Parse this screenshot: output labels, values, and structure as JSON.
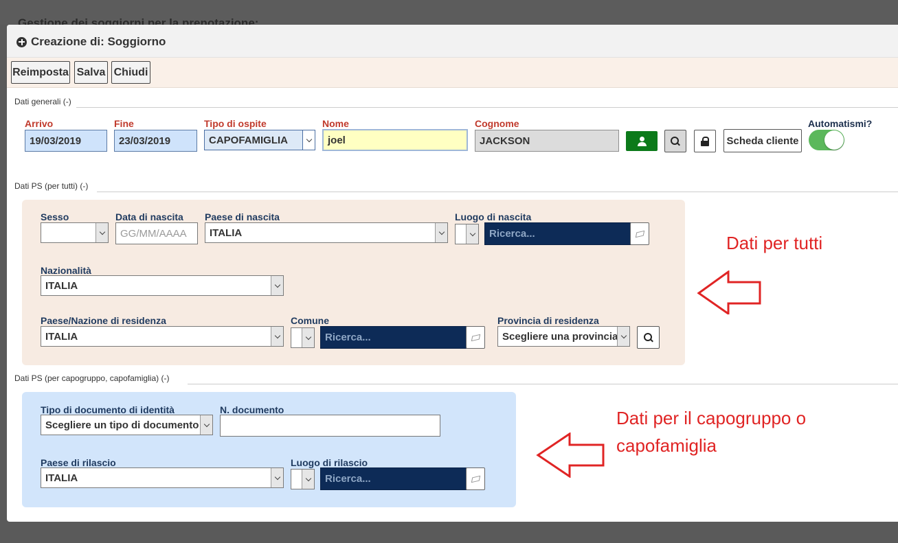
{
  "background": {
    "page_title": "Gestione dei soggiorni per la prenotazione:"
  },
  "dialog": {
    "title": "Creazione di: Soggiorno",
    "icon": "plus-circle-icon"
  },
  "toolbar": {
    "reset_label": "Reimposta",
    "save_label": "Salva",
    "close_label": "Chiudi"
  },
  "general": {
    "section_label": "Dati generali (-)",
    "arrivo_label": "Arrivo",
    "arrivo_value": "19/03/2019",
    "fine_label": "Fine",
    "fine_value": "23/03/2019",
    "tipo_label": "Tipo di ospite",
    "tipo_value": "CAPOFAMIGLIA",
    "nome_label": "Nome",
    "nome_value": "joel",
    "cognome_label": "Cognome",
    "cognome_value": "JACKSON",
    "scheda_label": "Scheda cliente",
    "automatismi_label": "Automatismi?",
    "automatismi_on": true
  },
  "ps_all": {
    "section_label": "Dati PS (per tutti) (-)",
    "sesso_label": "Sesso",
    "sesso_value": "",
    "nascita_label": "Data di nascita",
    "nascita_placeholder": "GG/MM/AAAA",
    "paese_nascita_label": "Paese di nascita",
    "paese_nascita_value": "ITALIA",
    "luogo_nascita_label": "Luogo di nascita",
    "ricerca_placeholder": "Ricerca...",
    "nazionalita_label": "Nazionalità",
    "nazionalita_value": "ITALIA",
    "residenza_label": "Paese/Nazione di residenza",
    "residenza_value": "ITALIA",
    "comune_label": "Comune",
    "provincia_label": "Provincia di residenza",
    "provincia_value": "Scegliere una provincia"
  },
  "ps_capo": {
    "section_label": "Dati PS (per capogruppo, capofamiglia) (-)",
    "doc_tipo_label": "Tipo di documento di identità",
    "doc_tipo_value": "Scegliere un tipo di documento",
    "doc_num_label": "N. documento",
    "doc_num_value": "",
    "paese_rilascio_label": "Paese di rilascio",
    "paese_rilascio_value": "ITALIA",
    "luogo_rilascio_label": "Luogo di rilascio",
    "ricerca_placeholder": "Ricerca..."
  },
  "annotations": {
    "tutti": "Dati per tutti",
    "capo_line1": "Dati per il capogruppo o",
    "capo_line2": "capofamiglia",
    "color": "#e02424"
  },
  "colors": {
    "ricerca_bg": "#0d2b57",
    "date_bg": "#cfe3fb",
    "nome_bg": "#ffffc2",
    "toggle_on": "#5cb85c",
    "panel_beige": "#f7ebe2",
    "panel_blue": "#d2e5fb"
  }
}
